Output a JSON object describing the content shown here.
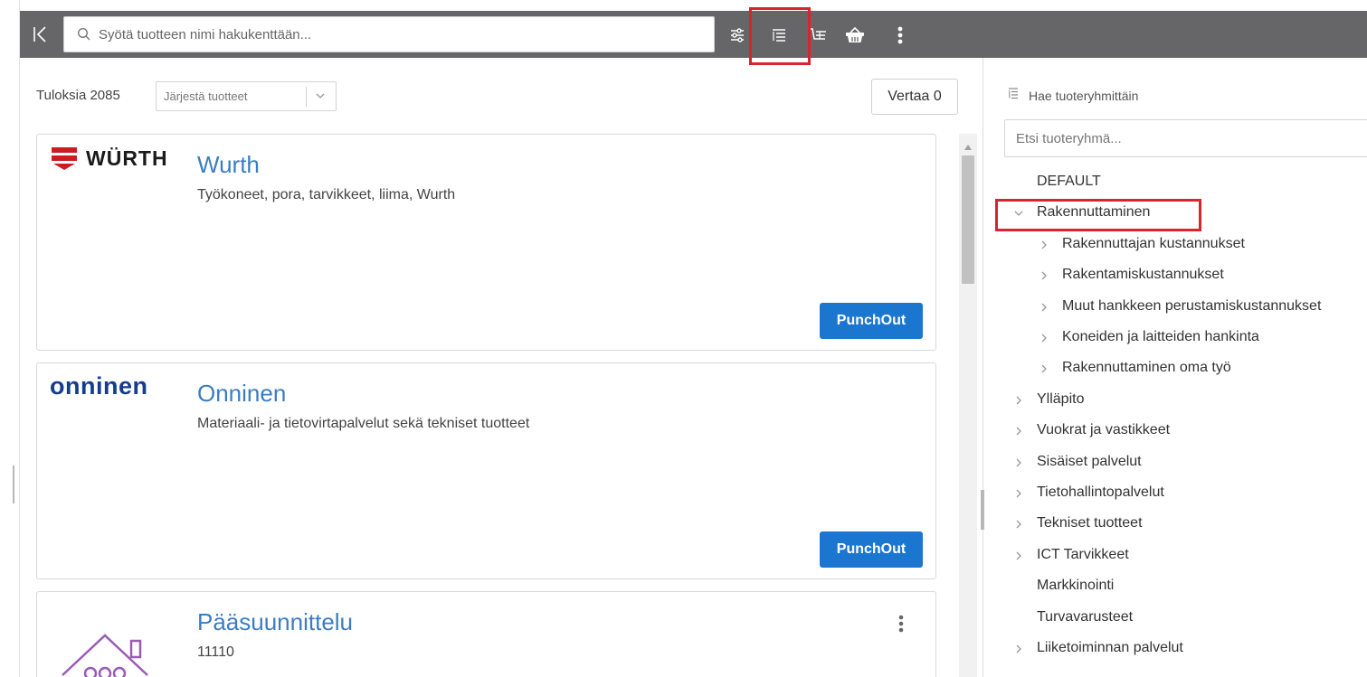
{
  "toolbar": {
    "search_placeholder": "Syötä tuotteen nimi hakukenttään...",
    "icons": [
      "collapse-left-icon",
      "filter-sliders-icon",
      "category-list-icon",
      "cart-list-icon",
      "basket-icon",
      "more-vertical-icon"
    ],
    "highlight_color": "#d9232d"
  },
  "results": {
    "count_label": "Tuloksia 2085",
    "sort_placeholder": "Järjestä tuotteet",
    "compare_label": "Vertaa 0"
  },
  "products": [
    {
      "logo_text": "WÜRTH",
      "title": "Wurth",
      "description": "Työkoneet, pora, tarvikkeet, liima, Wurth",
      "action_label": "PunchOut"
    },
    {
      "logo_text": "onninen",
      "title": "Onninen",
      "description": "Materiaali- ja tietovirtapalvelut sekä tekniset tuotteet",
      "action_label": "PunchOut"
    },
    {
      "logo_text": "",
      "title": "Pääsuunnittelu",
      "description": "11110"
    }
  ],
  "category_panel": {
    "header_label": "Hae tuoteryhmittäin",
    "search_placeholder": "Etsi tuoteryhmä...",
    "tree": [
      {
        "label": "DEFAULT",
        "level": 0,
        "chevron": "none"
      },
      {
        "label": "Rakennuttaminen",
        "level": 0,
        "chevron": "down"
      },
      {
        "label": "Rakennuttajan kustannukset",
        "level": 1,
        "chevron": "right"
      },
      {
        "label": "Rakentamiskustannukset",
        "level": 1,
        "chevron": "right"
      },
      {
        "label": "Muut hankkeen perustamiskustannukset",
        "level": 1,
        "chevron": "right"
      },
      {
        "label": "Koneiden ja laitteiden hankinta",
        "level": 1,
        "chevron": "right"
      },
      {
        "label": "Rakennuttaminen oma työ",
        "level": 1,
        "chevron": "right"
      },
      {
        "label": "Ylläpito",
        "level": 0,
        "chevron": "right"
      },
      {
        "label": "Vuokrat ja vastikkeet",
        "level": 0,
        "chevron": "right"
      },
      {
        "label": "Sisäiset palvelut",
        "level": 0,
        "chevron": "right"
      },
      {
        "label": "Tietohallintopalvelut",
        "level": 0,
        "chevron": "right"
      },
      {
        "label": "Tekniset tuotteet",
        "level": 0,
        "chevron": "right"
      },
      {
        "label": "ICT Tarvikkeet",
        "level": 0,
        "chevron": "right"
      },
      {
        "label": "Markkinointi",
        "level": 0,
        "chevron": "none"
      },
      {
        "label": "Turvavarusteet",
        "level": 0,
        "chevron": "none"
      },
      {
        "label": "Liiketoiminnan palvelut",
        "level": 0,
        "chevron": "right"
      }
    ]
  },
  "colors": {
    "toolbar_bg": "#666668",
    "link_blue": "#3b7dc4",
    "button_blue": "#1b76cf",
    "wurth_red": "#cc1c22",
    "onninen_blue": "#143d8d",
    "house_purple": "#9b5bb5"
  }
}
